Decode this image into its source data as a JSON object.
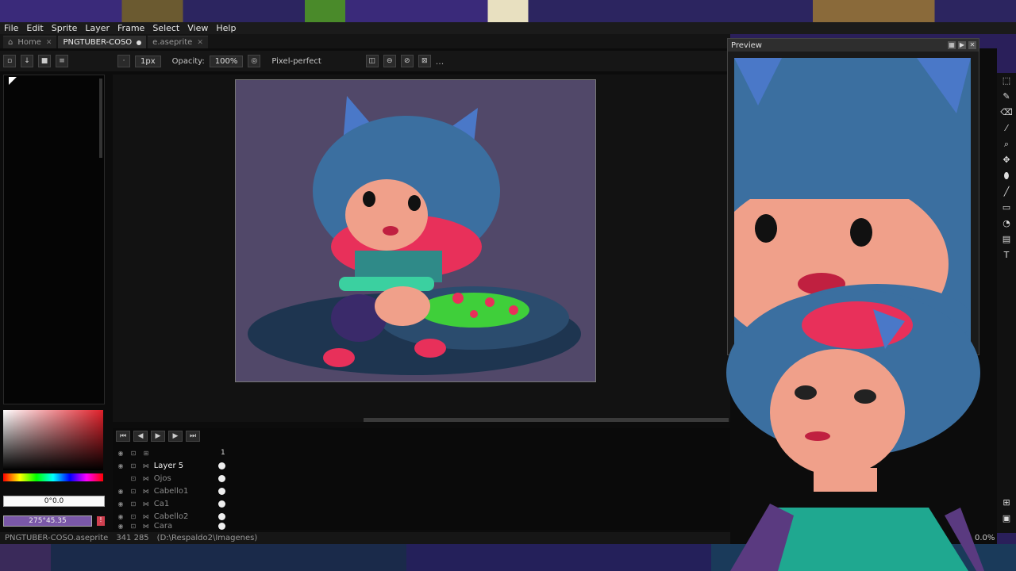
{
  "menu": [
    "File",
    "Edit",
    "Sprite",
    "Layer",
    "Frame",
    "Select",
    "View",
    "Help"
  ],
  "tabs": [
    {
      "label": "Home",
      "active": false
    },
    {
      "label": "PNGTUBER-COSO",
      "active": true
    },
    {
      "label": "e.aseprite",
      "active": false
    }
  ],
  "context_bar": {
    "brush_size": "1px",
    "opacity_label": "Opacity:",
    "opacity_value": "100%",
    "pixel_perfect_label": "Pixel-perfect",
    "more": "..."
  },
  "color": {
    "hsv": "0°0.0",
    "selected": "275°45.35"
  },
  "timeline": {
    "frame_number": "1",
    "layers": [
      {
        "name": "Layer 5",
        "selected": true
      },
      {
        "name": "Ojos",
        "selected": false
      },
      {
        "name": "Cabello1",
        "selected": false
      },
      {
        "name": "Ca1",
        "selected": false
      },
      {
        "name": "Cabello2",
        "selected": false
      },
      {
        "name": "Cara",
        "selected": false
      }
    ]
  },
  "status": {
    "file": "PNGTUBER-COSO.aseprite",
    "size": "341 285",
    "path": "(D:\\Respaldo2\\Imagenes)"
  },
  "preview": {
    "title": "Preview"
  },
  "zoom": "0.0%",
  "colors": {
    "sprite_bg": "#514869",
    "hair": "#3b6fa0",
    "accent_pink": "#e8305a"
  }
}
